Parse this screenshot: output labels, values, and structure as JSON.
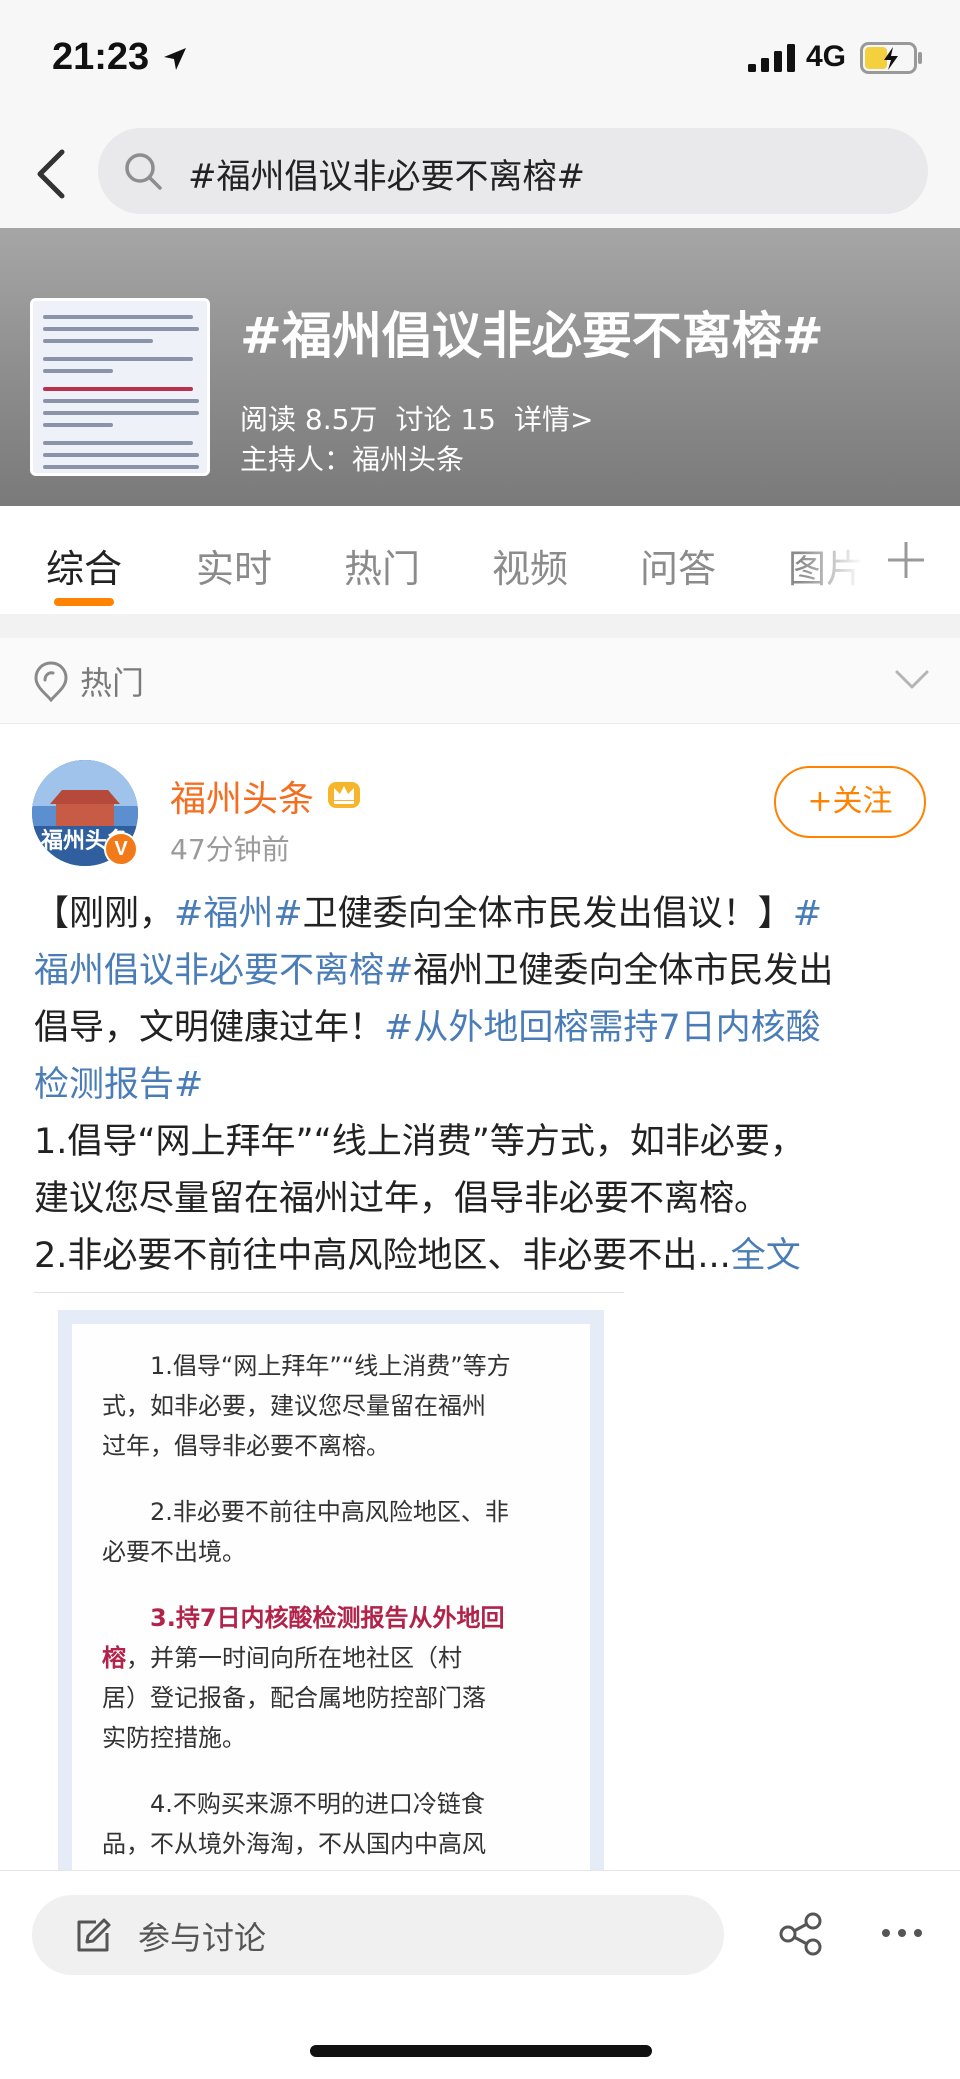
{
  "status_bar": {
    "time": "21:23",
    "network": "4G"
  },
  "search": {
    "query": "#福州倡议非必要不离榕#"
  },
  "topic": {
    "title": "#福州倡议非必要不离榕#",
    "reads": "阅读 8.5万",
    "discussions": "讨论 15",
    "details": "详情>",
    "host": "主持人：福州头条"
  },
  "tabs": [
    {
      "label": "综合"
    },
    {
      "label": "实时"
    },
    {
      "label": "热门"
    },
    {
      "label": "视频"
    },
    {
      "label": "问答"
    },
    {
      "label": "图片"
    }
  ],
  "filter": {
    "label": "热门"
  },
  "post": {
    "author": "福州头条",
    "avatar_text": "福州头条",
    "verified_badge": "V",
    "time": "47分钟前",
    "follow_label": "+关注",
    "body": {
      "l1_a": "【刚刚，",
      "l1_tag": "#福州#",
      "l1_b": "卫健委向全体市民发出倡议！】",
      "l1_tag2": "#",
      "l2_tag": "福州倡议非必要不离榕#",
      "l2_b": "福州卫健委向全体市民发出",
      "l3_a": "倡导，文明健康过年！",
      "l3_tag": "#从外地回榕需持7日内核酸",
      "l4_tag": "检测报告#",
      "l5": "1.倡导“网上拜年”“线上消费”等方式，如非必要，",
      "l6": "建议您尽量留在福州过年，倡导非必要不离榕。",
      "l7": "2.非必要不前往中高风险地区、非必要不出...",
      "full_text": "全文"
    },
    "image": {
      "p1_l1": "1.倡导“网上拜年”“线上消费”等方",
      "p1_l2": "式，如非必要，建议您尽量留在福州",
      "p1_l3": "过年，倡导非必要不离榕。",
      "p2_l1": "2.非必要不前往中高风险地区、非",
      "p2_l2": "必要不出境。",
      "p3_num": "3.",
      "p3_red": "持7日内核酸检测报告从外地回",
      "p3_red2": "榕",
      "p3_l2": "，并第一时间向所在地社区（村",
      "p3_l3": "居）登记报备，配合属地防控部门落",
      "p3_l4": "实防控措施。",
      "p4_l1": "4.不购买来源不明的进口冷链食",
      "p4_l2": "品，不从境外海淘，不从国内中高风"
    }
  },
  "bottom": {
    "discuss_label": "参与讨论"
  },
  "colors": {
    "accent": "#ff8200",
    "link": "#4a7db8",
    "author": "#f36e21"
  }
}
